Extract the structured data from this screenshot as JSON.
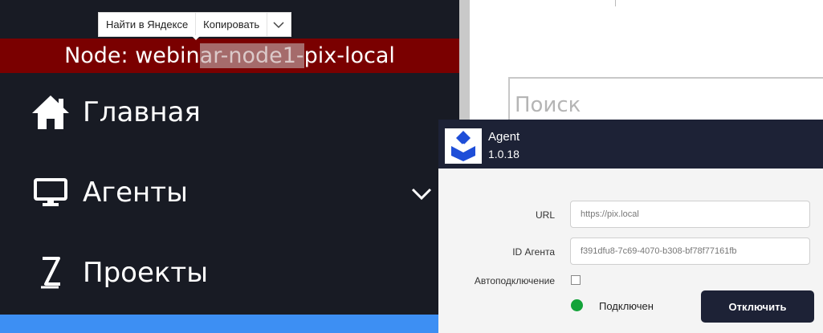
{
  "context_menu": {
    "search_label": "Найти в Яндексе",
    "copy_label": "Копировать",
    "more_icon": "chevron-down-icon"
  },
  "node_bar": {
    "prefix": "Node: webin",
    "highlighted": "ar-node1-",
    "suffix": "pix-local",
    "background": "#7a0000"
  },
  "sidebar": {
    "background": "#181b24",
    "items": [
      {
        "label": "Главная",
        "icon": "home-icon"
      },
      {
        "label": "Агенты",
        "icon": "monitor-icon",
        "expand_icon": "chevron-down-icon"
      },
      {
        "label": "Проекты",
        "icon": "projects-icon"
      }
    ],
    "active_color": "#3d8ff3"
  },
  "search": {
    "placeholder": "Поиск"
  },
  "agent": {
    "title": "Agent",
    "version": "1.0.18",
    "url_label": "URL",
    "url_value": "https://pix.local",
    "id_label": "ID Агента",
    "id_value": "f391dfu8-7c69-4070-b308-bf78f77161fb",
    "autoconnect_label": "Автоподключение",
    "autoconnect_checked": false,
    "status_text": "Подключен",
    "status_color": "#13a339",
    "disconnect_label": "Отключить",
    "header_color": "#1d2236"
  }
}
